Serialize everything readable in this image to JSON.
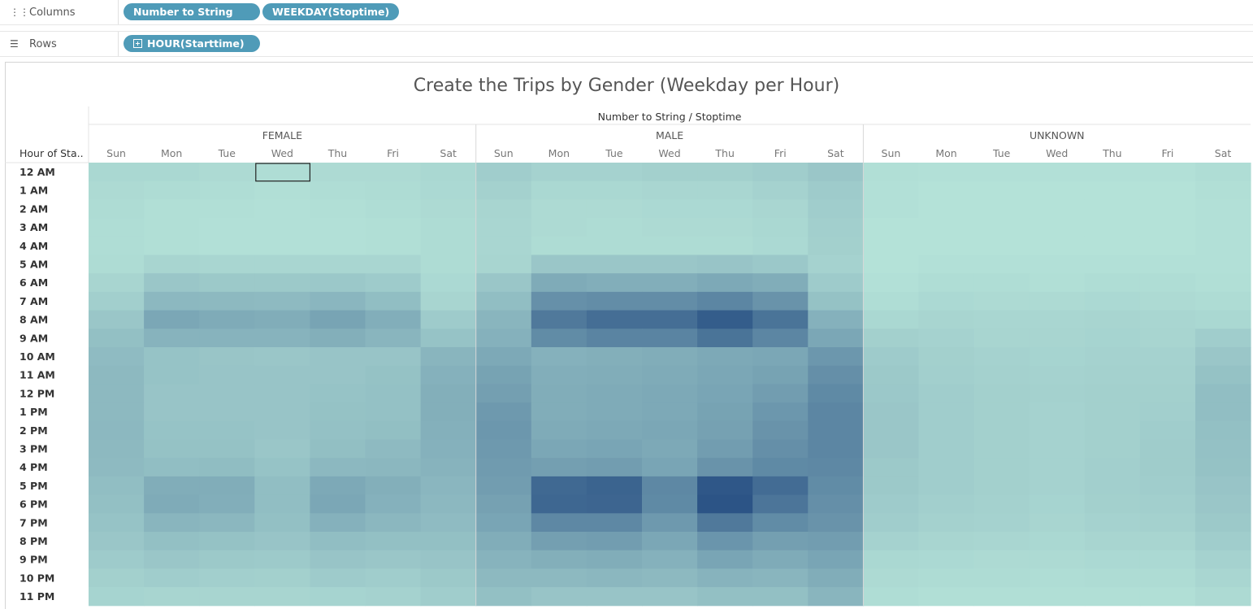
{
  "shelves": {
    "columns": {
      "label": "Columns",
      "pills": [
        "Number to String",
        "WEEKDAY(Stoptime)"
      ]
    },
    "rows": {
      "label": "Rows",
      "pills": [
        "HOUR(Starttime)"
      ]
    }
  },
  "chart_data": {
    "type": "heatmap",
    "title": "Create the Trips by Gender (Weekday per Hour)",
    "column_header": "Number to String / Stoptime",
    "row_header": "Hour of Sta..",
    "groups": [
      "FEMALE",
      "MALE",
      "UNKNOWN"
    ],
    "days": [
      "Sun",
      "Mon",
      "Tue",
      "Wed",
      "Thu",
      "Fri",
      "Sat"
    ],
    "hours": [
      "12 AM",
      "1 AM",
      "2 AM",
      "3 AM",
      "4 AM",
      "5 AM",
      "6 AM",
      "7 AM",
      "8 AM",
      "9 AM",
      "10 AM",
      "11 AM",
      "12 PM",
      "1 PM",
      "2 PM",
      "3 PM",
      "4 PM",
      "5 PM",
      "6 PM",
      "7 PM",
      "8 PM",
      "9 PM",
      "10 PM",
      "11 PM"
    ],
    "color_range": [
      "#b6e4d9",
      "#2c5486"
    ],
    "values": {
      "FEMALE": [
        [
          8,
          8,
          6,
          4,
          6,
          6,
          8
        ],
        [
          6,
          5,
          4,
          3,
          4,
          5,
          7
        ],
        [
          5,
          3,
          3,
          2,
          3,
          4,
          6
        ],
        [
          4,
          3,
          2,
          2,
          2,
          3,
          5
        ],
        [
          4,
          3,
          2,
          2,
          2,
          3,
          5
        ],
        [
          5,
          10,
          9,
          9,
          9,
          9,
          5
        ],
        [
          10,
          22,
          20,
          20,
          21,
          18,
          7
        ],
        [
          15,
          35,
          34,
          33,
          37,
          30,
          10
        ],
        [
          22,
          52,
          48,
          46,
          55,
          45,
          18
        ],
        [
          28,
          40,
          40,
          40,
          44,
          38,
          25
        ],
        [
          32,
          25,
          23,
          22,
          24,
          24,
          38
        ],
        [
          34,
          25,
          24,
          24,
          24,
          26,
          42
        ],
        [
          34,
          24,
          24,
          24,
          25,
          27,
          44
        ],
        [
          34,
          24,
          24,
          24,
          26,
          27,
          44
        ],
        [
          35,
          25,
          25,
          24,
          27,
          29,
          43
        ],
        [
          34,
          26,
          26,
          22,
          29,
          33,
          42
        ],
        [
          33,
          30,
          31,
          25,
          35,
          36,
          40
        ],
        [
          30,
          46,
          46,
          30,
          50,
          44,
          37
        ],
        [
          28,
          48,
          45,
          30,
          52,
          42,
          35
        ],
        [
          25,
          38,
          36,
          28,
          42,
          36,
          32
        ],
        [
          22,
          28,
          26,
          24,
          30,
          28,
          28
        ],
        [
          18,
          22,
          20,
          19,
          24,
          22,
          24
        ],
        [
          14,
          16,
          15,
          14,
          18,
          16,
          20
        ],
        [
          11,
          10,
          10,
          10,
          11,
          12,
          16
        ]
      ],
      "MALE": [
        [
          16,
          12,
          12,
          14,
          14,
          16,
          22
        ],
        [
          13,
          8,
          8,
          9,
          9,
          12,
          18
        ],
        [
          10,
          6,
          6,
          7,
          7,
          9,
          16
        ],
        [
          9,
          6,
          5,
          6,
          6,
          8,
          15
        ],
        [
          9,
          5,
          5,
          5,
          5,
          7,
          14
        ],
        [
          10,
          22,
          22,
          22,
          24,
          21,
          12
        ],
        [
          22,
          48,
          45,
          45,
          50,
          46,
          18
        ],
        [
          30,
          75,
          78,
          78,
          86,
          72,
          26
        ],
        [
          38,
          100,
          112,
          112,
          132,
          106,
          42
        ],
        [
          42,
          80,
          88,
          88,
          106,
          86,
          52
        ],
        [
          50,
          42,
          44,
          46,
          50,
          52,
          68
        ],
        [
          56,
          45,
          46,
          48,
          52,
          56,
          76
        ],
        [
          60,
          46,
          48,
          50,
          54,
          62,
          82
        ],
        [
          66,
          46,
          48,
          50,
          56,
          68,
          86
        ],
        [
          68,
          48,
          50,
          52,
          58,
          72,
          86
        ],
        [
          66,
          52,
          54,
          50,
          62,
          76,
          86
        ],
        [
          64,
          60,
          62,
          54,
          72,
          82,
          84
        ],
        [
          62,
          118,
          124,
          84,
          138,
          115,
          80
        ],
        [
          58,
          120,
          122,
          82,
          142,
          104,
          76
        ],
        [
          54,
          84,
          84,
          66,
          100,
          80,
          72
        ],
        [
          46,
          60,
          62,
          52,
          70,
          60,
          62
        ],
        [
          40,
          44,
          46,
          42,
          54,
          48,
          54
        ],
        [
          34,
          34,
          36,
          34,
          40,
          38,
          46
        ],
        [
          28,
          24,
          24,
          24,
          28,
          28,
          38
        ]
      ],
      "UNKNOWN": [
        [
          3,
          2,
          2,
          2,
          2,
          2,
          4
        ],
        [
          2,
          1,
          1,
          1,
          1,
          1,
          3
        ],
        [
          2,
          1,
          1,
          1,
          1,
          1,
          2
        ],
        [
          1,
          1,
          1,
          1,
          1,
          1,
          2
        ],
        [
          1,
          1,
          1,
          1,
          1,
          1,
          2
        ],
        [
          1,
          2,
          2,
          2,
          2,
          2,
          2
        ],
        [
          2,
          4,
          4,
          3,
          4,
          4,
          3
        ],
        [
          4,
          7,
          6,
          6,
          7,
          6,
          5
        ],
        [
          8,
          10,
          9,
          9,
          10,
          9,
          8
        ],
        [
          14,
          12,
          10,
          10,
          11,
          10,
          16
        ],
        [
          18,
          14,
          12,
          11,
          12,
          12,
          22
        ],
        [
          20,
          15,
          13,
          12,
          13,
          13,
          26
        ],
        [
          21,
          16,
          14,
          13,
          14,
          14,
          30
        ],
        [
          22,
          16,
          14,
          12,
          14,
          15,
          30
        ],
        [
          22,
          16,
          14,
          12,
          14,
          16,
          28
        ],
        [
          22,
          16,
          14,
          12,
          14,
          17,
          27
        ],
        [
          20,
          16,
          14,
          12,
          15,
          17,
          26
        ],
        [
          20,
          16,
          14,
          12,
          15,
          16,
          24
        ],
        [
          18,
          15,
          13,
          11,
          14,
          15,
          22
        ],
        [
          16,
          13,
          12,
          10,
          12,
          13,
          20
        ],
        [
          12,
          10,
          9,
          8,
          10,
          10,
          16
        ],
        [
          8,
          7,
          6,
          6,
          7,
          7,
          12
        ],
        [
          6,
          5,
          5,
          4,
          5,
          5,
          9
        ],
        [
          4,
          3,
          3,
          3,
          3,
          3,
          6
        ]
      ]
    },
    "max_value": 142,
    "selected_cell": {
      "group": "FEMALE",
      "day": "Wed",
      "hour": "12 AM"
    }
  }
}
